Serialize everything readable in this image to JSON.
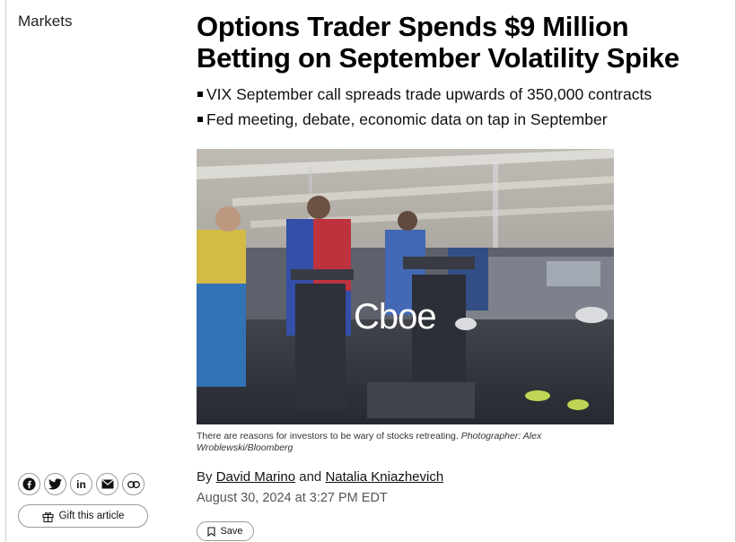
{
  "section": {
    "label": "Markets"
  },
  "article": {
    "headline": "Options Trader Spends $9 Million Betting on September Volatility Spike",
    "bullets": [
      "VIX September call spreads trade upwards of 350,000 contracts",
      "Fed meeting, debate, economic data on tap in September"
    ],
    "image": {
      "logo_text": "Cboe",
      "caption": "There are reasons for investors to be wary of stocks retreating.",
      "credit": "Photographer: Alex Wroblewski/Bloomberg"
    },
    "byline": {
      "prefix": "By",
      "author1": "David Marino",
      "joiner": "and",
      "author2": "Natalia Kniazhevich"
    },
    "date": "August 30, 2024 at 3:27 PM EDT"
  },
  "actions": {
    "save_label": "Save",
    "gift_label": "Gift this article",
    "share_icons": [
      "facebook-icon",
      "twitter-icon",
      "linkedin-icon",
      "email-icon",
      "link-icon"
    ]
  }
}
